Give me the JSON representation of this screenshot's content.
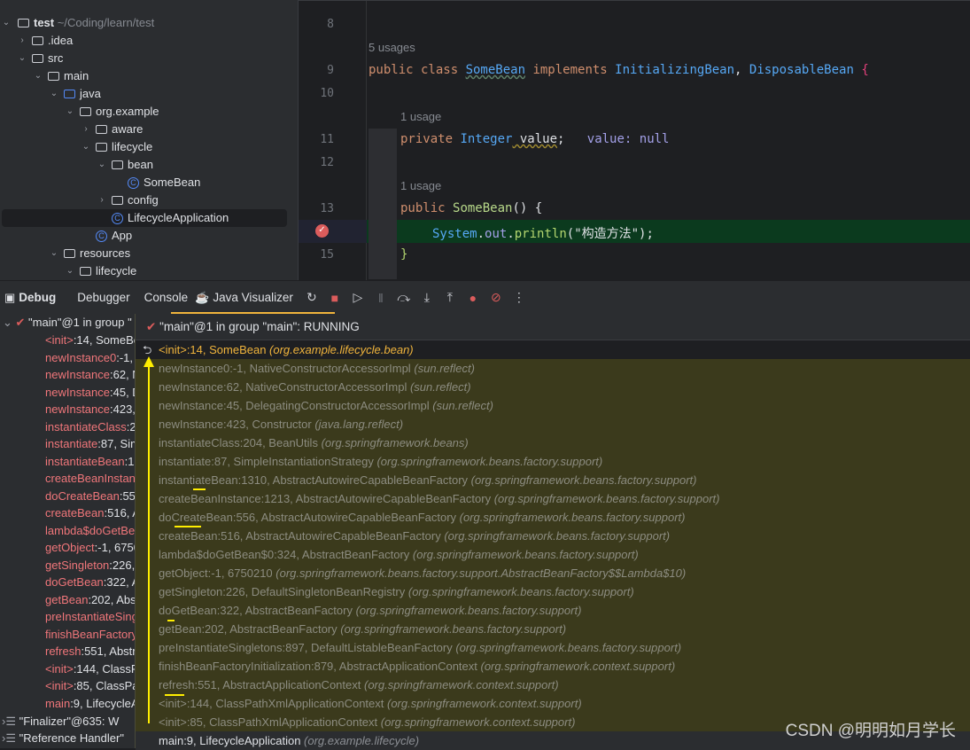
{
  "project": {
    "root": "test",
    "root_path": "~/Coding/learn/test",
    "items": [
      {
        "label": ".idea",
        "depth": 1,
        "icon": "folder-icon",
        "chevron": "right"
      },
      {
        "label": "src",
        "depth": 1,
        "icon": "folder-icon",
        "chevron": "down"
      },
      {
        "label": "main",
        "depth": 2,
        "icon": "folder-icon",
        "chevron": "down"
      },
      {
        "label": "java",
        "depth": 3,
        "icon": "source-folder-icon",
        "chevron": "down"
      },
      {
        "label": "org.example",
        "depth": 4,
        "icon": "package-icon",
        "chevron": "down"
      },
      {
        "label": "aware",
        "depth": 5,
        "icon": "package-icon",
        "chevron": "right"
      },
      {
        "label": "lifecycle",
        "depth": 5,
        "icon": "package-icon",
        "chevron": "down"
      },
      {
        "label": "bean",
        "depth": 6,
        "icon": "package-icon",
        "chevron": "down"
      },
      {
        "label": "SomeBean",
        "depth": 7,
        "icon": "class-icon",
        "chevron": ""
      },
      {
        "label": "config",
        "depth": 6,
        "icon": "package-icon",
        "chevron": "right"
      },
      {
        "label": "LifecycleApplication",
        "depth": 6,
        "icon": "class-icon",
        "chevron": "",
        "selected": true
      },
      {
        "label": "App",
        "depth": 5,
        "icon": "class-icon",
        "chevron": ""
      },
      {
        "label": "resources",
        "depth": 3,
        "icon": "resources-folder-icon",
        "chevron": "down"
      },
      {
        "label": "lifecycle",
        "depth": 4,
        "icon": "folder-icon",
        "chevron": "down"
      }
    ]
  },
  "editor": {
    "line_numbers": [
      "8",
      "9",
      "10",
      "11",
      "12",
      "13",
      "15"
    ],
    "hints": {
      "usages5": "5 usages",
      "usage1a": "1 usage",
      "usage1b": "1 usage"
    },
    "line9": {
      "kw": "public class ",
      "cls": "SomeBean",
      "impl": " implements ",
      "i1": "InitializingBean",
      "comma": ", ",
      "i2": "DisposableBean",
      "brace": " {"
    },
    "line11": {
      "kw": "private ",
      "type": "Integer",
      "var": " value",
      "semi": ";",
      "inline": "value: null"
    },
    "line13": {
      "kw": "public ",
      "fn": "SomeBean",
      "rest": "() {"
    },
    "line14": {
      "sys": "System",
      "dot1": ".",
      "out": "out",
      "dot2": ".",
      "fn": "println",
      "str": "(\"构造方法\");"
    },
    "line15": "}"
  },
  "toolbar": {
    "debug": "Debug",
    "tabs": [
      "Debugger",
      "Console",
      "Java Visualizer"
    ]
  },
  "thread": {
    "label": "\"main\"@1 in group \"main\": RUNNING",
    "left_label": "\"main\"@1 in group \"",
    "other_threads": [
      "\"Finalizer\"@635: W",
      "\"Reference Handler\""
    ]
  },
  "frames": [
    {
      "m": "<init>",
      "r": ":14, SomeBean ",
      "p": "(org.example.lifecycle.bean)"
    },
    {
      "m": "newInstance0",
      "r": ":-1, NativeConstructorAccessorImpl ",
      "p": "(sun.reflect)"
    },
    {
      "m": "newInstance",
      "r": ":62, NativeConstructorAccessorImpl ",
      "p": "(sun.reflect)"
    },
    {
      "m": "newInstance",
      "r": ":45, DelegatingConstructorAccessorImpl ",
      "p": "(sun.reflect)"
    },
    {
      "m": "newInstance",
      "r": ":423, Constructor ",
      "p": "(java.lang.reflect)"
    },
    {
      "m": "instantiateClass",
      "r": ":204, BeanUtils ",
      "p": "(org.springframework.beans)"
    },
    {
      "m": "instantiate",
      "r": ":87, SimpleInstantiationStrategy ",
      "p": "(org.springframework.beans.factory.support)"
    },
    {
      "m": "instantiateBean",
      "r": ":1310, AbstractAutowireCapableBeanFactory ",
      "p": "(org.springframework.beans.factory.support)"
    },
    {
      "m": "createBeanInstance",
      "r": ":1213, AbstractAutowireCapableBeanFactory ",
      "p": "(org.springframework.beans.factory.support)"
    },
    {
      "m": "doCreateBean",
      "r": ":556, AbstractAutowireCapableBeanFactory ",
      "p": "(org.springframework.beans.factory.support)"
    },
    {
      "m": "createBean",
      "r": ":516, AbstractAutowireCapableBeanFactory ",
      "p": "(org.springframework.beans.factory.support)"
    },
    {
      "m": "lambda$doGetBean$0",
      "r": ":324, AbstractBeanFactory ",
      "p": "(org.springframework.beans.factory.support)"
    },
    {
      "m": "getObject",
      "r": ":-1, 6750210 ",
      "p": "(org.springframework.beans.factory.support.AbstractBeanFactory$$Lambda$10)"
    },
    {
      "m": "getSingleton",
      "r": ":226, DefaultSingletonBeanRegistry ",
      "p": "(org.springframework.beans.factory.support)"
    },
    {
      "m": "doGetBean",
      "r": ":322, AbstractBeanFactory ",
      "p": "(org.springframework.beans.factory.support)"
    },
    {
      "m": "getBean",
      "r": ":202, AbstractBeanFactory ",
      "p": "(org.springframework.beans.factory.support)"
    },
    {
      "m": "preInstantiateSingletons",
      "r": ":897, DefaultListableBeanFactory ",
      "p": "(org.springframework.beans.factory.support)"
    },
    {
      "m": "finishBeanFactoryInitialization",
      "r": ":879, AbstractApplicationContext ",
      "p": "(org.springframework.context.support)"
    },
    {
      "m": "refresh",
      "r": ":551, AbstractApplicationContext ",
      "p": "(org.springframework.context.support)"
    },
    {
      "m": "<init>",
      "r": ":144, ClassPathXmlApplicationContext ",
      "p": "(org.springframework.context.support)"
    },
    {
      "m": "<init>",
      "r": ":85, ClassPathXmlApplicationContext ",
      "p": "(org.springframework.context.support)"
    },
    {
      "m": "main",
      "r": ":9, LifecycleApplication ",
      "p": "(org.example.lifecycle)"
    }
  ],
  "watermark": "CSDN @明明如月学长"
}
